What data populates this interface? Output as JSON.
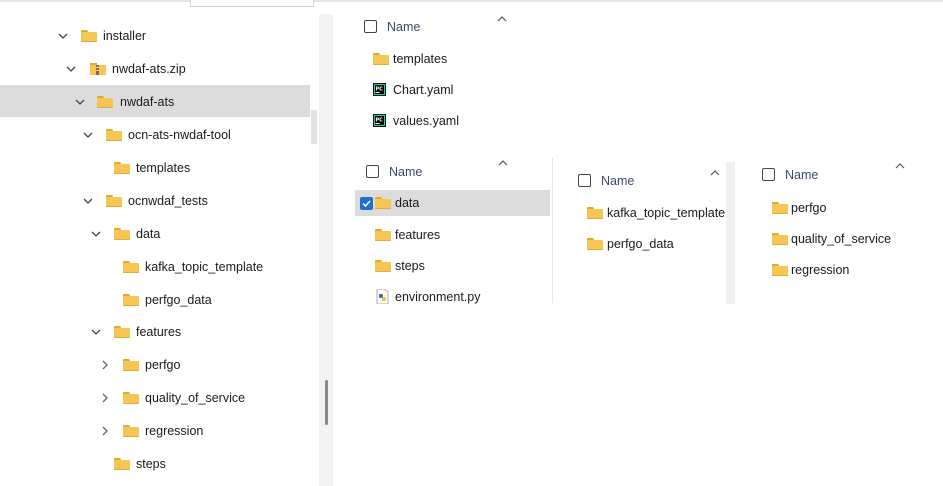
{
  "tree": {
    "items": [
      {
        "label": "installer",
        "chevron": "down",
        "icon": "folder"
      },
      {
        "label": "nwdaf-ats.zip",
        "chevron": "down",
        "icon": "zip"
      },
      {
        "label": "nwdaf-ats",
        "chevron": "down",
        "icon": "folder",
        "selected": true
      },
      {
        "label": "ocn-ats-nwdaf-tool",
        "chevron": "down",
        "icon": "folder"
      },
      {
        "label": "templates",
        "chevron": "none",
        "icon": "folder"
      },
      {
        "label": "ocnwdaf_tests",
        "chevron": "down",
        "icon": "folder"
      },
      {
        "label": "data",
        "chevron": "down",
        "icon": "folder"
      },
      {
        "label": "kafka_topic_template",
        "chevron": "none",
        "icon": "folder"
      },
      {
        "label": "perfgo_data",
        "chevron": "none",
        "icon": "folder"
      },
      {
        "label": "features",
        "chevron": "down",
        "icon": "folder"
      },
      {
        "label": "perfgo",
        "chevron": "right",
        "icon": "folder"
      },
      {
        "label": "quality_of_service",
        "chevron": "right",
        "icon": "folder"
      },
      {
        "label": "regression",
        "chevron": "right",
        "icon": "folder"
      },
      {
        "label": "steps",
        "chevron": "none",
        "icon": "folder"
      }
    ]
  },
  "pane1": {
    "header": "Name",
    "items": [
      {
        "label": "templates",
        "icon": "folder"
      },
      {
        "label": "Chart.yaml",
        "icon": "pycharm-file"
      },
      {
        "label": "values.yaml",
        "icon": "pycharm-file"
      }
    ]
  },
  "pane2": {
    "header": "Name",
    "items": [
      {
        "label": "data",
        "icon": "folder",
        "selected": true
      },
      {
        "label": "features",
        "icon": "folder"
      },
      {
        "label": "steps",
        "icon": "folder"
      },
      {
        "label": "environment.py",
        "icon": "python-file"
      }
    ]
  },
  "pane3": {
    "header": "Name",
    "items": [
      {
        "label": "kafka_topic_template",
        "icon": "folder"
      },
      {
        "label": "perfgo_data",
        "icon": "folder"
      }
    ]
  },
  "pane4": {
    "header": "Name",
    "items": [
      {
        "label": "perfgo",
        "icon": "folder"
      },
      {
        "label": "quality_of_service",
        "icon": "folder"
      },
      {
        "label": "regression",
        "icon": "folder"
      }
    ]
  },
  "colors": {
    "selection": "#dcdcdc",
    "folder": "#f6c654",
    "checkbox_checked": "#1f6fd1"
  }
}
